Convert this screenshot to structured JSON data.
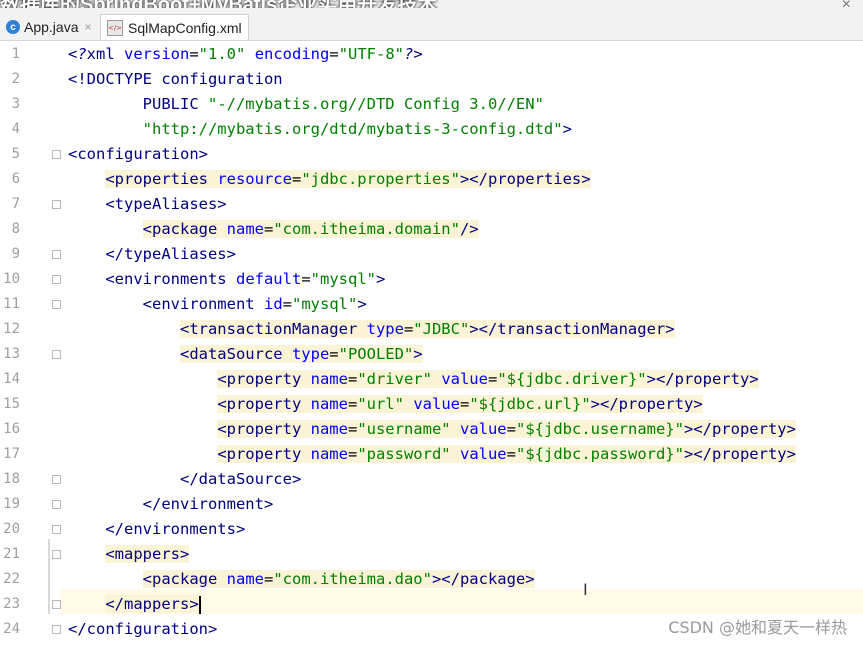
{
  "window": {
    "overlay_title": "数据库的SpringBoot+MyBatis企业实用开发技术",
    "tabs": [
      {
        "label": "App.java",
        "icon": "java-class-icon",
        "active": false
      },
      {
        "label": "SqlMapConfig.xml",
        "icon": "xml-file-icon",
        "active": true
      }
    ]
  },
  "editor": {
    "line_numbers": [
      "1",
      "2",
      "3",
      "4",
      "5",
      "6",
      "7",
      "8",
      "9",
      "10",
      "11",
      "12",
      "13",
      "14",
      "15",
      "16",
      "17",
      "18",
      "19",
      "20",
      "21",
      "22",
      "23",
      "24"
    ],
    "lines": [
      [
        [
          "q",
          "<?"
        ],
        [
          "t",
          "xml "
        ],
        [
          "a",
          "version"
        ],
        [
          "p",
          "="
        ],
        [
          "v",
          "\"1.0\""
        ],
        [
          "p",
          " "
        ],
        [
          "a",
          "encoding"
        ],
        [
          "p",
          "="
        ],
        [
          "v",
          "\"UTF-8\""
        ],
        [
          "q",
          "?>"
        ]
      ],
      [
        [
          "t",
          "<!DOCTYPE configuration"
        ]
      ],
      [
        [
          "t",
          "        PUBLIC "
        ],
        [
          "v",
          "\"-//mybatis.org//DTD Config 3.0//EN\""
        ]
      ],
      [
        [
          "p",
          "        "
        ],
        [
          "v",
          "\"http://mybatis.org/dtd/mybatis-3-config.dtd\""
        ],
        [
          "t",
          ">"
        ]
      ],
      [
        [
          "t",
          "<configuration>"
        ]
      ],
      [
        [
          "p",
          "    "
        ],
        [
          "t",
          "<properties "
        ],
        [
          "a",
          "resource"
        ],
        [
          "p",
          "="
        ],
        [
          "v",
          "\"jdbc.properties\""
        ],
        [
          "t",
          "></properties>"
        ]
      ],
      [
        [
          "p",
          "    "
        ],
        [
          "t",
          "<typeAliases>"
        ]
      ],
      [
        [
          "p",
          "        "
        ],
        [
          "t",
          "<package "
        ],
        [
          "a",
          "name"
        ],
        [
          "p",
          "="
        ],
        [
          "v",
          "\"com.itheima.domain\""
        ],
        [
          "t",
          "/>"
        ]
      ],
      [
        [
          "p",
          "    "
        ],
        [
          "t",
          "</typeAliases>"
        ]
      ],
      [
        [
          "p",
          "    "
        ],
        [
          "t",
          "<environments "
        ],
        [
          "a",
          "default"
        ],
        [
          "p",
          "="
        ],
        [
          "v",
          "\"mysql\""
        ],
        [
          "t",
          ">"
        ]
      ],
      [
        [
          "p",
          "        "
        ],
        [
          "t",
          "<environment "
        ],
        [
          "a",
          "id"
        ],
        [
          "p",
          "="
        ],
        [
          "v",
          "\"mysql\""
        ],
        [
          "t",
          ">"
        ]
      ],
      [
        [
          "p",
          "            "
        ],
        [
          "t",
          "<transactionManager "
        ],
        [
          "a",
          "type"
        ],
        [
          "p",
          "="
        ],
        [
          "v",
          "\"JDBC\""
        ],
        [
          "t",
          "></transactionManager>"
        ]
      ],
      [
        [
          "p",
          "            "
        ],
        [
          "t",
          "<dataSource "
        ],
        [
          "a",
          "type"
        ],
        [
          "p",
          "="
        ],
        [
          "v",
          "\"POOLED\""
        ],
        [
          "t",
          ">"
        ]
      ],
      [
        [
          "p",
          "                "
        ],
        [
          "t",
          "<property "
        ],
        [
          "a",
          "name"
        ],
        [
          "p",
          "="
        ],
        [
          "v",
          "\"driver\""
        ],
        [
          "p",
          " "
        ],
        [
          "a",
          "value"
        ],
        [
          "p",
          "="
        ],
        [
          "v",
          "\"${jdbc.driver}\""
        ],
        [
          "t",
          "></property>"
        ]
      ],
      [
        [
          "p",
          "                "
        ],
        [
          "t",
          "<property "
        ],
        [
          "a",
          "name"
        ],
        [
          "p",
          "="
        ],
        [
          "v",
          "\"url\""
        ],
        [
          "p",
          " "
        ],
        [
          "a",
          "value"
        ],
        [
          "p",
          "="
        ],
        [
          "v",
          "\"${jdbc.url}\""
        ],
        [
          "t",
          "></property>"
        ]
      ],
      [
        [
          "p",
          "                "
        ],
        [
          "t",
          "<property "
        ],
        [
          "a",
          "name"
        ],
        [
          "p",
          "="
        ],
        [
          "v",
          "\"username\""
        ],
        [
          "p",
          " "
        ],
        [
          "a",
          "value"
        ],
        [
          "p",
          "="
        ],
        [
          "v",
          "\"${jdbc.username}\""
        ],
        [
          "t",
          "></property>"
        ]
      ],
      [
        [
          "p",
          "                "
        ],
        [
          "t",
          "<property "
        ],
        [
          "a",
          "name"
        ],
        [
          "p",
          "="
        ],
        [
          "v",
          "\"password\""
        ],
        [
          "p",
          " "
        ],
        [
          "a",
          "value"
        ],
        [
          "p",
          "="
        ],
        [
          "v",
          "\"${jdbc.password}\""
        ],
        [
          "t",
          "></property>"
        ]
      ],
      [
        [
          "p",
          "            "
        ],
        [
          "t",
          "</dataSource>"
        ]
      ],
      [
        [
          "p",
          "        "
        ],
        [
          "t",
          "</environment>"
        ]
      ],
      [
        [
          "p",
          "    "
        ],
        [
          "t",
          "</environments>"
        ]
      ],
      [
        [
          "p",
          "    "
        ],
        [
          "t",
          "<mappers>"
        ]
      ],
      [
        [
          "p",
          "        "
        ],
        [
          "t",
          "<package "
        ],
        [
          "a",
          "name"
        ],
        [
          "p",
          "="
        ],
        [
          "v",
          "\"com.itheima.dao\""
        ],
        [
          "t",
          "></package>"
        ]
      ],
      [
        [
          "p",
          "    "
        ],
        [
          "t",
          "</mappers>"
        ]
      ],
      [
        [
          "t",
          "</configuration>"
        ]
      ]
    ],
    "highlighted_lines": [
      6,
      8,
      12,
      13,
      14,
      15,
      16,
      17,
      21,
      22,
      23
    ],
    "fold_lines": [
      5,
      7,
      9,
      10,
      11,
      13,
      18,
      19,
      20,
      21,
      23,
      24
    ],
    "current_line": 23
  },
  "watermark": "CSDN @她和夏天一样热"
}
